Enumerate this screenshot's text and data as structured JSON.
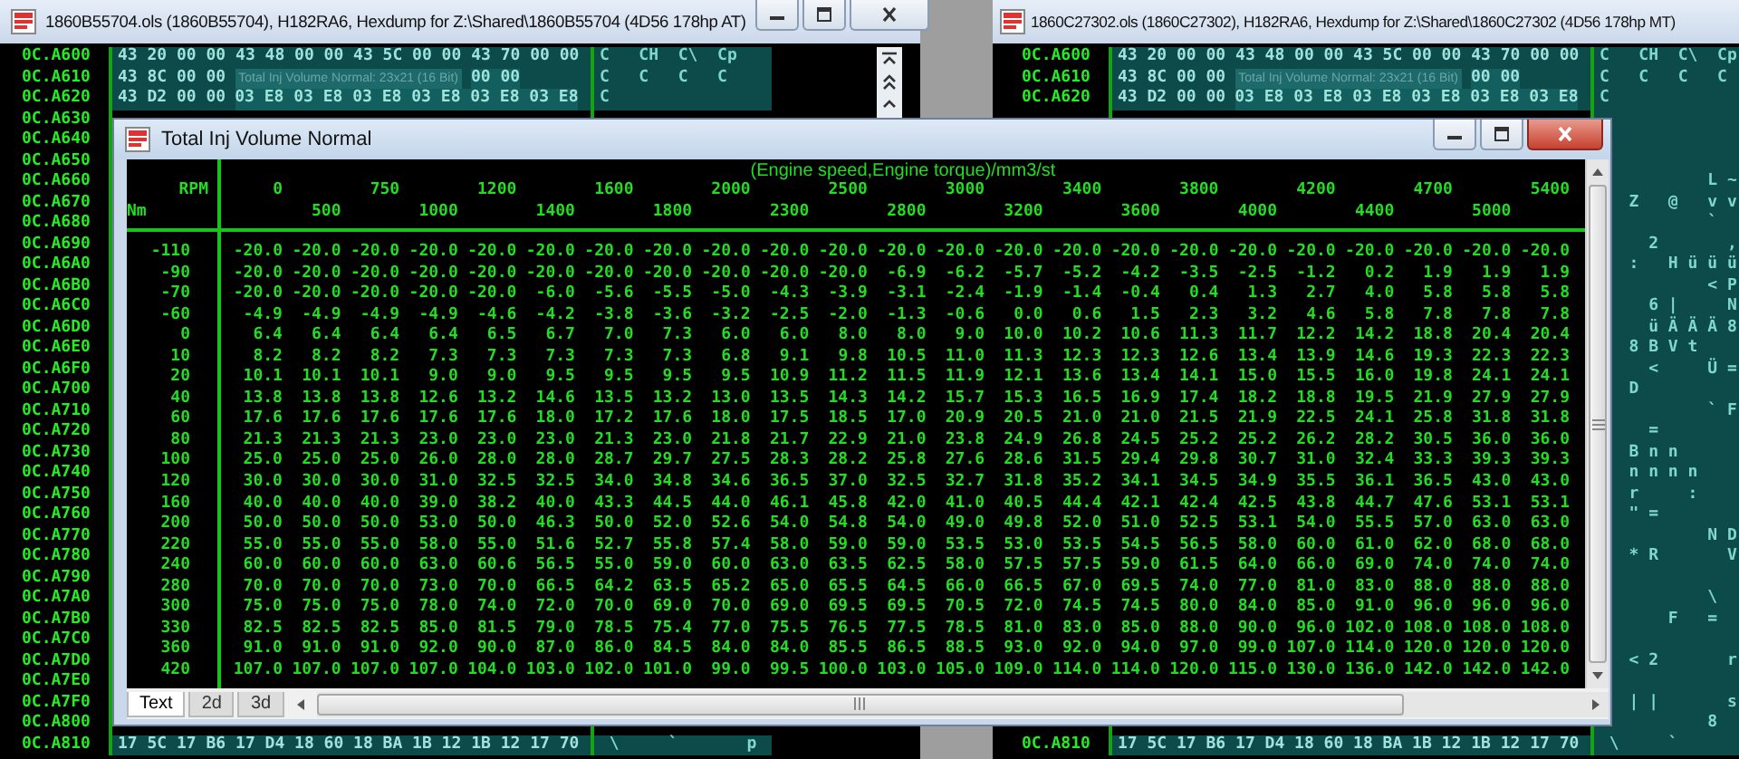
{
  "hexdump_windows": [
    {
      "title": "1860B55704.ols (1860B55704), H182RA6, Hexdump for Z:\\Shared\\1860B55704 (4D56 178hp AT)",
      "rows": [
        {
          "address": "0C.A600",
          "hex": [
            {
              "kind": "bytes",
              "text": "43 20 00 00 43 48 00 00 43 5C 00 00 43 70 00 00"
            }
          ],
          "ascii": "C   CH  C\\  Cp"
        },
        {
          "address": "0C.A610",
          "hex": [
            {
              "kind": "bytes",
              "text": "43 8C 00 00"
            },
            {
              "kind": "map_label",
              "text": "Total Inj Volume Normal: 23x21 (16 Bit)"
            },
            {
              "kind": "map_data",
              "text": "00 00"
            }
          ],
          "ascii": "C   C   C   C"
        },
        {
          "address": "0C.A620",
          "hex": [
            {
              "kind": "bytes",
              "text": "43 D2 00 00"
            },
            {
              "kind": "map_data",
              "text": "03 E8 03 E8 03 E8 03 E8 03 E8 03 E8"
            }
          ],
          "ascii": "C"
        },
        {
          "address": "0C.A630"
        },
        {
          "address": "0C.A640"
        },
        {
          "address": "0C.A650"
        },
        {
          "address": "0C.A660"
        },
        {
          "address": "0C.A670"
        },
        {
          "address": "0C.A680"
        },
        {
          "address": "0C.A690"
        },
        {
          "address": "0C.A6A0"
        },
        {
          "address": "0C.A6B0"
        },
        {
          "address": "0C.A6C0"
        },
        {
          "address": "0C.A6D0"
        },
        {
          "address": "0C.A6E0"
        },
        {
          "address": "0C.A6F0"
        },
        {
          "address": "0C.A700"
        },
        {
          "address": "0C.A710"
        },
        {
          "address": "0C.A720"
        },
        {
          "address": "0C.A730"
        },
        {
          "address": "0C.A740"
        },
        {
          "address": "0C.A750"
        },
        {
          "address": "0C.A760"
        },
        {
          "address": "0C.A770"
        },
        {
          "address": "0C.A780"
        },
        {
          "address": "0C.A790"
        },
        {
          "address": "0C.A7A0"
        },
        {
          "address": "0C.A7B0"
        },
        {
          "address": "0C.A7C0"
        },
        {
          "address": "0C.A7D0"
        },
        {
          "address": "0C.A7E0"
        },
        {
          "address": "0C.A7F0"
        },
        {
          "address": "0C.A800"
        },
        {
          "address": "0C.A810",
          "hex": [
            {
              "kind": "bytes",
              "text": "17 5C 17 B6 17 D4 18 60 18 BA 1B 12 1B 12 17 70"
            }
          ],
          "ascii": " \\     `       p"
        }
      ]
    },
    {
      "title": "1860C27302.ols (1860C27302), H182RA6, Hexdump for Z:\\Shared\\1860C27302 (4D56 178hp MT)",
      "rows": [
        {
          "address": "0C.A600",
          "hex": [
            {
              "kind": "bytes",
              "text": "43 20 00 00 43 48 00 00 43 5C 00 00 43 70 00 00"
            }
          ],
          "ascii": "C   CH  C\\  Cp"
        },
        {
          "address": "0C.A610",
          "hex": [
            {
              "kind": "bytes",
              "text": "43 8C 00 00"
            },
            {
              "kind": "map_label",
              "text": "Total Inj Volume Normal: 23x21 (16 Bit)"
            },
            {
              "kind": "map_data",
              "text": "00 00"
            }
          ],
          "ascii": "C   C   C   C"
        },
        {
          "address": "0C.A620",
          "hex": [
            {
              "kind": "bytes",
              "text": "43 D2 00 00"
            },
            {
              "kind": "map_data",
              "text": "03 E8 03 E8 03 E8 03 E8 03 E8 03 E8"
            }
          ],
          "ascii": "C"
        },
        {},
        {},
        {},
        {
          "ascii": "           L ~"
        },
        {
          "ascii": "   Z   @   v v"
        },
        {
          "ascii": "           `"
        },
        {
          "ascii": "     2       ,"
        },
        {
          "ascii": "   :   H ü ü ü"
        },
        {
          "ascii": "           < P"
        },
        {
          "ascii": "     6 |     N"
        },
        {
          "ascii": "     ü Ä Ä Ä 8"
        },
        {
          "ascii": "   8 B V t"
        },
        {
          "ascii": "     <     Ü ="
        },
        {
          "ascii": "   D"
        },
        {
          "ascii": "           ` F"
        },
        {
          "ascii": "     ="
        },
        {
          "ascii": "   B n n"
        },
        {
          "ascii": "   n n n n"
        },
        {
          "ascii": "   r     :"
        },
        {
          "ascii": "   \" ="
        },
        {
          "ascii": "           N D"
        },
        {
          "ascii": "   * R       V"
        },
        {},
        {
          "ascii": "           \\"
        },
        {
          "ascii": "       F   ="
        },
        {},
        {
          "ascii": "   < 2       r"
        },
        {},
        {
          "ascii": "   | |       s"
        },
        {
          "ascii": "           8"
        },
        {
          "address": "0C.A810",
          "hex": [
            {
              "kind": "bytes",
              "text": "17 5C 17 B6 17 D4 18 60 18 BA 1B 12 1B 12 17 70"
            }
          ],
          "ascii": " \\     `"
        }
      ]
    }
  ],
  "table_window": {
    "title": "Total Inj Volume Normal",
    "axis_title": "(Engine speed,Engine torque)/mm3/st",
    "x_label": "RPM",
    "y_label": "Nm",
    "columns": [
      "0",
      "500",
      "750",
      "1000",
      "1200",
      "1400",
      "1600",
      "1800",
      "2000",
      "2300",
      "2500",
      "2800",
      "3000",
      "3200",
      "3400",
      "3600",
      "3800",
      "4000",
      "4200",
      "4400",
      "4700",
      "5000",
      "5400"
    ],
    "rows": [
      {
        "label": "-110",
        "values": [
          "-20.0",
          "-20.0",
          "-20.0",
          "-20.0",
          "-20.0",
          "-20.0",
          "-20.0",
          "-20.0",
          "-20.0",
          "-20.0",
          "-20.0",
          "-20.0",
          "-20.0",
          "-20.0",
          "-20.0",
          "-20.0",
          "-20.0",
          "-20.0",
          "-20.0",
          "-20.0",
          "-20.0",
          "-20.0",
          "-20.0"
        ]
      },
      {
        "label": "-90",
        "values": [
          "-20.0",
          "-20.0",
          "-20.0",
          "-20.0",
          "-20.0",
          "-20.0",
          "-20.0",
          "-20.0",
          "-20.0",
          "-20.0",
          "-20.0",
          "-6.9",
          "-6.2",
          "-5.7",
          "-5.2",
          "-4.2",
          "-3.5",
          "-2.5",
          "-1.2",
          "0.2",
          "1.9",
          "1.9",
          "1.9"
        ]
      },
      {
        "label": "-70",
        "values": [
          "-20.0",
          "-20.0",
          "-20.0",
          "-20.0",
          "-20.0",
          "-6.0",
          "-5.6",
          "-5.5",
          "-5.0",
          "-4.3",
          "-3.9",
          "-3.1",
          "-2.4",
          "-1.9",
          "-1.4",
          "-0.4",
          "0.4",
          "1.3",
          "2.7",
          "4.0",
          "5.8",
          "5.8",
          "5.8"
        ]
      },
      {
        "label": "-60",
        "values": [
          "-4.9",
          "-4.9",
          "-4.9",
          "-4.9",
          "-4.6",
          "-4.2",
          "-3.8",
          "-3.6",
          "-3.2",
          "-2.5",
          "-2.0",
          "-1.3",
          "-0.6",
          "0.0",
          "0.6",
          "1.5",
          "2.3",
          "3.2",
          "4.6",
          "5.8",
          "7.8",
          "7.8",
          "7.8"
        ]
      },
      {
        "label": "0",
        "values": [
          "6.4",
          "6.4",
          "6.4",
          "6.4",
          "6.5",
          "6.7",
          "7.0",
          "7.3",
          "6.0",
          "6.0",
          "8.0",
          "8.0",
          "9.0",
          "10.0",
          "10.2",
          "10.6",
          "11.3",
          "11.7",
          "12.2",
          "14.2",
          "18.8",
          "20.4",
          "20.4"
        ]
      },
      {
        "label": "10",
        "values": [
          "8.2",
          "8.2",
          "8.2",
          "7.3",
          "7.3",
          "7.3",
          "7.3",
          "7.3",
          "6.8",
          "9.1",
          "9.8",
          "10.5",
          "11.0",
          "11.3",
          "12.3",
          "12.3",
          "12.6",
          "13.4",
          "13.9",
          "14.6",
          "19.3",
          "22.3",
          "22.3"
        ]
      },
      {
        "label": "20",
        "values": [
          "10.1",
          "10.1",
          "10.1",
          "9.0",
          "9.0",
          "9.5",
          "9.5",
          "9.5",
          "9.5",
          "10.9",
          "11.2",
          "11.5",
          "11.9",
          "12.1",
          "13.6",
          "13.4",
          "14.1",
          "15.0",
          "15.5",
          "16.0",
          "19.8",
          "24.1",
          "24.1"
        ]
      },
      {
        "label": "40",
        "values": [
          "13.8",
          "13.8",
          "13.8",
          "12.6",
          "13.2",
          "14.6",
          "13.5",
          "13.2",
          "13.0",
          "13.5",
          "14.3",
          "14.2",
          "15.7",
          "15.3",
          "16.5",
          "16.9",
          "17.4",
          "18.2",
          "18.8",
          "19.5",
          "21.9",
          "27.9",
          "27.9"
        ]
      },
      {
        "label": "60",
        "values": [
          "17.6",
          "17.6",
          "17.6",
          "17.6",
          "17.6",
          "18.0",
          "17.2",
          "17.6",
          "18.0",
          "17.5",
          "18.5",
          "17.0",
          "20.9",
          "20.5",
          "21.0",
          "21.0",
          "21.5",
          "21.9",
          "22.5",
          "24.1",
          "25.8",
          "31.8",
          "31.8"
        ]
      },
      {
        "label": "80",
        "values": [
          "21.3",
          "21.3",
          "21.3",
          "23.0",
          "23.0",
          "23.0",
          "21.3",
          "23.0",
          "21.8",
          "21.7",
          "22.9",
          "21.0",
          "23.8",
          "24.9",
          "26.8",
          "24.5",
          "25.2",
          "25.2",
          "26.2",
          "28.2",
          "30.5",
          "36.0",
          "36.0"
        ]
      },
      {
        "label": "100",
        "values": [
          "25.0",
          "25.0",
          "25.0",
          "26.0",
          "28.0",
          "28.0",
          "28.7",
          "29.7",
          "27.5",
          "28.3",
          "28.2",
          "25.8",
          "27.6",
          "28.6",
          "31.5",
          "29.4",
          "29.8",
          "30.7",
          "31.0",
          "32.4",
          "33.3",
          "39.3",
          "39.3"
        ]
      },
      {
        "label": "120",
        "values": [
          "30.0",
          "30.0",
          "30.0",
          "31.0",
          "32.5",
          "32.5",
          "34.0",
          "34.8",
          "34.6",
          "36.5",
          "37.0",
          "32.5",
          "32.7",
          "31.8",
          "35.2",
          "34.1",
          "34.5",
          "34.9",
          "35.5",
          "36.1",
          "36.5",
          "43.0",
          "43.0"
        ]
      },
      {
        "label": "160",
        "values": [
          "40.0",
          "40.0",
          "40.0",
          "39.0",
          "38.2",
          "40.0",
          "43.3",
          "44.5",
          "44.0",
          "46.1",
          "45.8",
          "42.0",
          "41.0",
          "40.5",
          "44.4",
          "42.1",
          "42.4",
          "42.5",
          "43.8",
          "44.7",
          "47.6",
          "53.1",
          "53.1"
        ]
      },
      {
        "label": "200",
        "values": [
          "50.0",
          "50.0",
          "50.0",
          "53.0",
          "50.0",
          "46.3",
          "50.0",
          "52.0",
          "52.6",
          "54.0",
          "54.8",
          "54.0",
          "49.0",
          "49.8",
          "52.0",
          "51.0",
          "52.5",
          "53.1",
          "54.0",
          "55.5",
          "57.0",
          "63.0",
          "63.0"
        ]
      },
      {
        "label": "220",
        "values": [
          "55.0",
          "55.0",
          "55.0",
          "58.0",
          "55.0",
          "51.6",
          "52.7",
          "55.8",
          "57.4",
          "58.0",
          "59.0",
          "59.0",
          "53.5",
          "53.0",
          "53.5",
          "54.5",
          "56.5",
          "58.0",
          "60.0",
          "61.0",
          "62.0",
          "68.0",
          "68.0"
        ]
      },
      {
        "label": "240",
        "values": [
          "60.0",
          "60.0",
          "60.0",
          "63.0",
          "60.6",
          "56.5",
          "55.0",
          "59.0",
          "60.0",
          "63.0",
          "63.5",
          "62.5",
          "58.0",
          "57.5",
          "57.5",
          "59.0",
          "61.5",
          "64.0",
          "66.0",
          "69.0",
          "74.0",
          "74.0",
          "74.0"
        ]
      },
      {
        "label": "280",
        "values": [
          "70.0",
          "70.0",
          "70.0",
          "73.0",
          "70.0",
          "66.5",
          "64.2",
          "63.5",
          "65.2",
          "65.0",
          "65.5",
          "64.5",
          "66.0",
          "66.5",
          "67.0",
          "69.5",
          "74.0",
          "77.0",
          "81.0",
          "83.0",
          "88.0",
          "88.0",
          "88.0"
        ]
      },
      {
        "label": "300",
        "values": [
          "75.0",
          "75.0",
          "75.0",
          "78.0",
          "74.0",
          "72.0",
          "70.0",
          "69.0",
          "70.0",
          "69.0",
          "69.5",
          "69.5",
          "70.5",
          "72.0",
          "74.5",
          "74.5",
          "80.0",
          "84.0",
          "85.0",
          "91.0",
          "96.0",
          "96.0",
          "96.0"
        ]
      },
      {
        "label": "330",
        "values": [
          "82.5",
          "82.5",
          "82.5",
          "85.0",
          "81.5",
          "79.0",
          "78.5",
          "75.4",
          "77.0",
          "75.5",
          "76.5",
          "77.5",
          "78.5",
          "81.0",
          "83.0",
          "85.0",
          "88.0",
          "90.0",
          "96.0",
          "102.0",
          "108.0",
          "108.0",
          "108.0"
        ]
      },
      {
        "label": "360",
        "values": [
          "91.0",
          "91.0",
          "91.0",
          "92.0",
          "90.0",
          "87.0",
          "86.0",
          "84.5",
          "84.0",
          "84.0",
          "85.5",
          "86.5",
          "88.5",
          "93.0",
          "92.0",
          "94.0",
          "97.0",
          "99.0",
          "107.0",
          "114.0",
          "120.0",
          "120.0",
          "120.0"
        ]
      },
      {
        "label": "420",
        "values": [
          "107.0",
          "107.0",
          "107.0",
          "107.0",
          "104.0",
          "103.0",
          "102.0",
          "101.0",
          "99.0",
          "99.5",
          "100.0",
          "103.0",
          "105.0",
          "109.0",
          "114.0",
          "114.0",
          "120.0",
          "115.0",
          "130.0",
          "136.0",
          "142.0",
          "142.0",
          "142.0"
        ]
      }
    ],
    "tabs": [
      {
        "label": "Text",
        "selected": true
      },
      {
        "label": "2d",
        "selected": false
      },
      {
        "label": "3d",
        "selected": false
      }
    ]
  }
}
